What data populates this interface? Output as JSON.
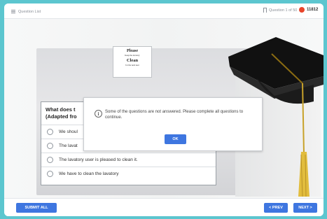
{
  "topbar": {
    "question_list_label": "Question List",
    "question_counter": "Question 1 of 50",
    "timer": "11812",
    "icons": {
      "menu": "menu-icon",
      "bookmark": "bookmark-icon",
      "timer": "timer-dot-icon"
    }
  },
  "sign": {
    "line1": "Please",
    "line2": "Keep the lavatory",
    "line3": "Clean",
    "line4": "for the next user"
  },
  "question": {
    "title": "What does t (Adapted fro",
    "options": [
      {
        "label": "We shoul"
      },
      {
        "label": "The lavat"
      },
      {
        "label": "The lavatory user is pleased to clean it."
      },
      {
        "label": "We have to clean the lavatory"
      }
    ]
  },
  "modal": {
    "icon": "info-icon",
    "message": "Some of the questions are not answered. Please complete all questions to continue.",
    "ok_label": "OK"
  },
  "footer": {
    "submit_label": "SUBMIT ALL",
    "prev_label": "< PREV",
    "next_label": "NEXT >"
  },
  "colors": {
    "background": "#5cc6cf",
    "accent": "#3e76e0",
    "timer_dot": "#e8452b"
  }
}
